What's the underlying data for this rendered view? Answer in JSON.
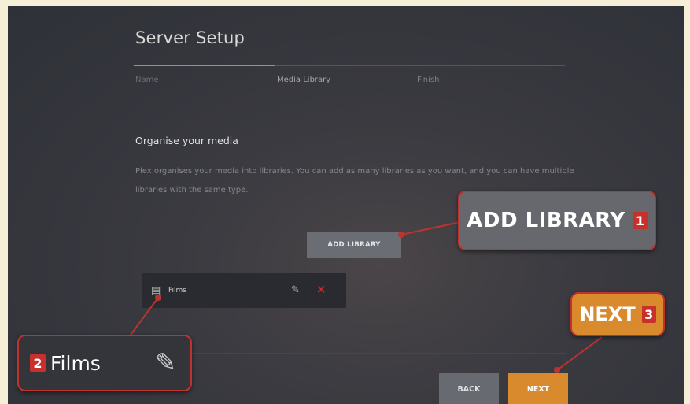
{
  "page": {
    "title": "Server Setup",
    "steps": [
      "Name",
      "Media Library",
      "Finish"
    ],
    "heading": "Organise your media",
    "description": "Plex organises your media into libraries. You can add as many libraries as you want, and you can have multiple libraries with the same type."
  },
  "buttons": {
    "add_library": "ADD LIBRARY",
    "back": "BACK",
    "next": "NEXT"
  },
  "library": {
    "name": "Films",
    "icon": "film-icon"
  },
  "callouts": {
    "add_library": {
      "label": "ADD LIBRARY",
      "number": "1"
    },
    "films": {
      "label": "Films",
      "number": "2"
    },
    "next": {
      "label": "NEXT",
      "number": "3"
    }
  },
  "colors": {
    "accent": "#d88a2c",
    "callout_border": "#c0322e",
    "delete": "#c0322e"
  }
}
